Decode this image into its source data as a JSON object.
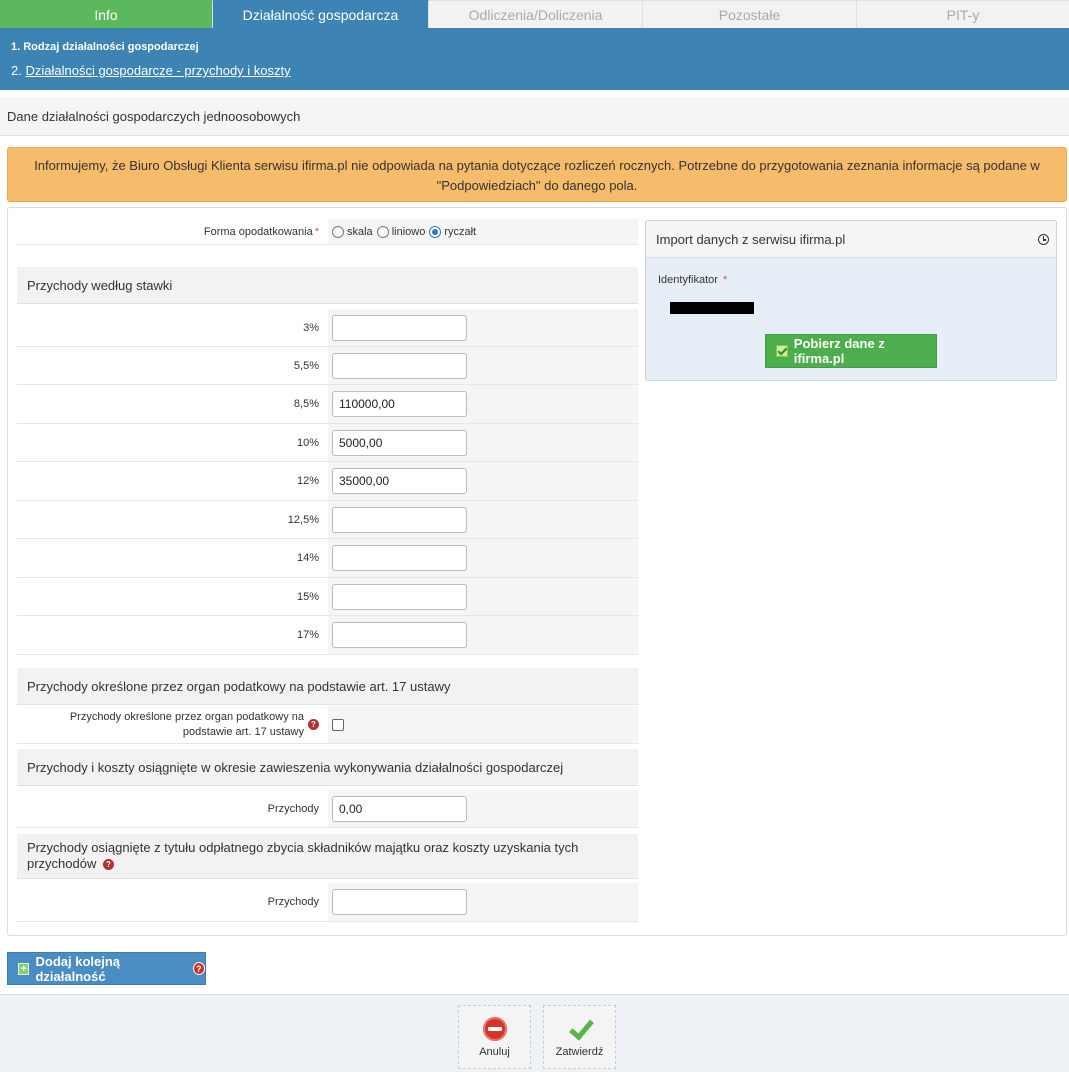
{
  "tabs": [
    {
      "label": "Info"
    },
    {
      "label": "Działalność gospodarcza"
    },
    {
      "label": "Odliczenia/Doliczenia"
    },
    {
      "label": "Pozostałe"
    },
    {
      "label": "PIT-y"
    }
  ],
  "steps": {
    "step1": "1. Rodzaj działalności gospodarczej",
    "step2_num": "2.",
    "step2_link": "Działalności gospodarcze - przychody i koszty"
  },
  "section_title": "Dane działalności gospodarczych jednoosobowych",
  "notice": "Informujemy, że Biuro Obsługi Klienta serwisu ifirma.pl nie odpowiada na pytania dotyczące rozliczeń rocznych. Potrzebne do przygotowania zeznania informacje są podane w \"Podpowiedziach\" do danego pola.",
  "forma": {
    "label": "Forma opodatkowania",
    "required_mark": "*",
    "options": [
      "skala",
      "liniowo",
      "ryczałt"
    ],
    "selected": "ryczałt"
  },
  "przychody_stawki": {
    "header": "Przychody według stawki",
    "rates": [
      {
        "label": "3%",
        "value": ""
      },
      {
        "label": "5,5%",
        "value": ""
      },
      {
        "label": "8,5%",
        "value": "110000,00"
      },
      {
        "label": "10%",
        "value": "5000,00"
      },
      {
        "label": "12%",
        "value": "35000,00"
      },
      {
        "label": "12,5%",
        "value": ""
      },
      {
        "label": "14%",
        "value": ""
      },
      {
        "label": "15%",
        "value": ""
      },
      {
        "label": "17%",
        "value": ""
      }
    ]
  },
  "art17": {
    "header": "Przychody określone przez organ podatkowy na podstawie art. 17 ustawy",
    "checkbox_label": "Przychody określone przez organ podatkowy na podstawie art. 17 ustawy",
    "checked": false
  },
  "zawieszenie": {
    "header": "Przychody i koszty osiągnięte w okresie zawieszenia wykonywania działalności gospodarczej",
    "field_label": "Przychody",
    "value": "0,00"
  },
  "zbycie": {
    "header": "Przychody osiągnięte z tytułu odpłatnego zbycia składników majątku oraz koszty uzyskania tych przychodów",
    "field_label": "Przychody",
    "value": ""
  },
  "import_panel": {
    "title": "Import danych z serwisu ifirma.pl",
    "ident_label": "Identyfikator",
    "required_mark": "*",
    "button": "Pobierz dane z ifirma.pl"
  },
  "add_button": "Dodaj kolejną działalność",
  "footer": {
    "cancel": "Anuluj",
    "confirm": "Zatwierdź"
  },
  "help_glyph": "?",
  "plus_glyph": "+",
  "colors": {
    "tab_info": "#5cb85c",
    "tab_active": "#3d83b3",
    "notice_bg": "#f7bc6b",
    "import_bg": "#e8eef8",
    "green_button": "#4cae4c",
    "blue_button": "#4a8cc4"
  }
}
